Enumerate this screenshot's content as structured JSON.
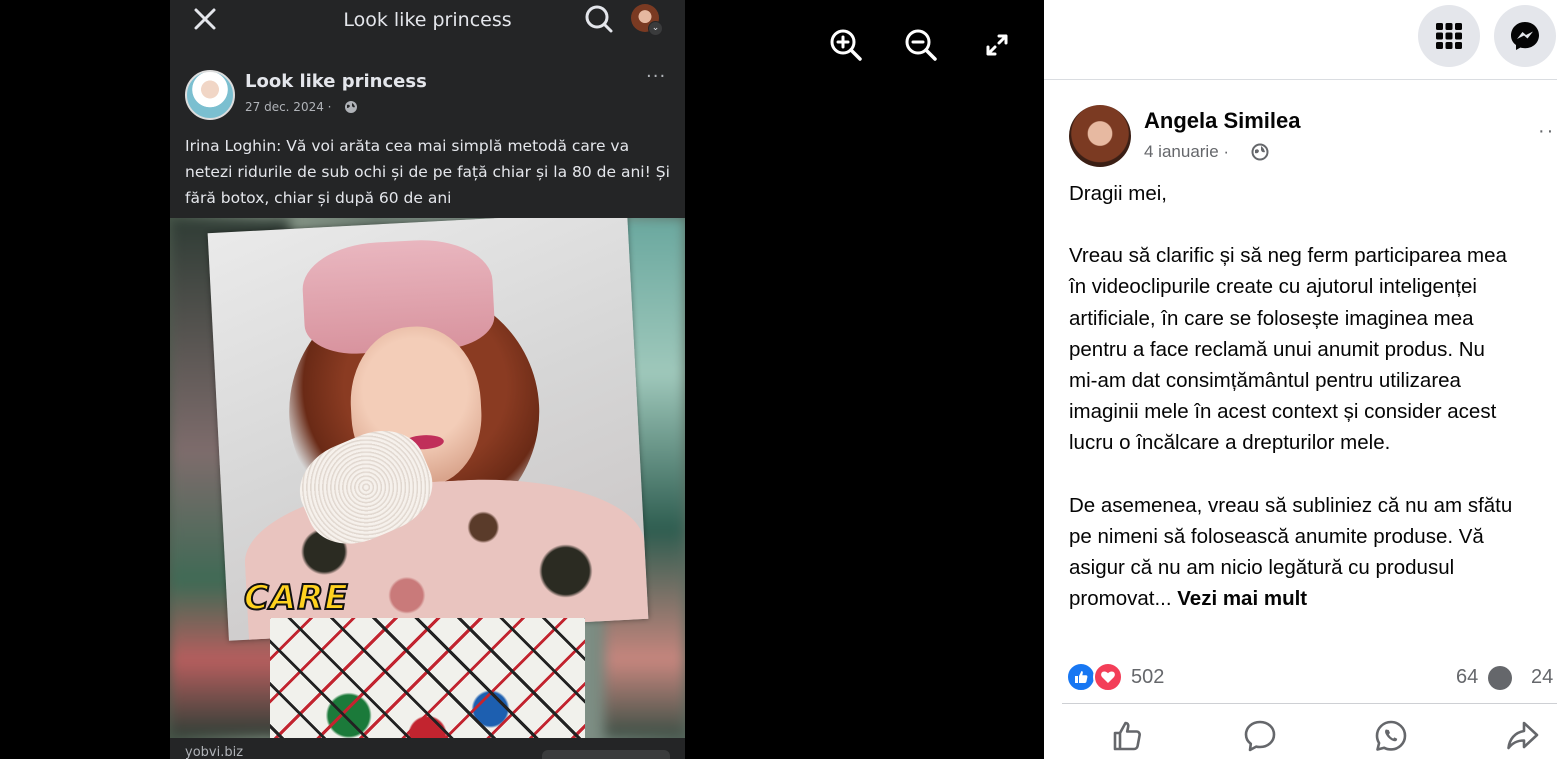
{
  "viewer": {
    "phone_title": "Look like princess",
    "post": {
      "page_name": "Look like princess",
      "date": "27 dec. 2024 ·",
      "more": "···",
      "text": "Irina Loghin: Vă voi arăta cea mai simplă metodă care va netezi ridurile de sub ochi și de pe față chiar și la 80 de ani! Și fără botox, chiar și după 60 de ani",
      "image_caption": "CARE",
      "link_domain": "yobvi.biz"
    },
    "controls": {
      "zoom_in": "zoom-in-icon",
      "zoom_out": "zoom-out-icon",
      "fullscreen": "fullscreen-icon"
    }
  },
  "panel": {
    "top_buttons": [
      "menu-grid-icon",
      "messenger-icon"
    ],
    "author": {
      "name": "Angela Similea",
      "date": "4 ianuarie ·",
      "more": "··"
    },
    "post": {
      "greeting": "Dragii mei,",
      "p1_lines": [
        "Vreau să clarific și să neg ferm participarea mea",
        "în videoclipurile create cu ajutorul inteligenței",
        "artificiale, în care se folosește imaginea mea",
        "pentru a face reclamă unui anumit produs. Nu",
        "mi-am dat consimțământul pentru utilizarea",
        "imaginii mele în acest context și consider acest",
        "lucru o încălcare a drepturilor mele."
      ],
      "p2_lines": [
        "De asemenea, vreau să subliniez că nu am sfătu",
        "pe nimeni să folosească anumite produse. Vă",
        "asigur că nu am nicio legătură cu produsul",
        "promovat..."
      ],
      "see_more": "Vezi mai mult"
    },
    "stats": {
      "reactions": "502",
      "comments": "64",
      "shares": "24"
    },
    "colors": {
      "like_blue": "#1877f2",
      "love_red": "#f33e58",
      "secondary_text": "#65676b"
    }
  }
}
